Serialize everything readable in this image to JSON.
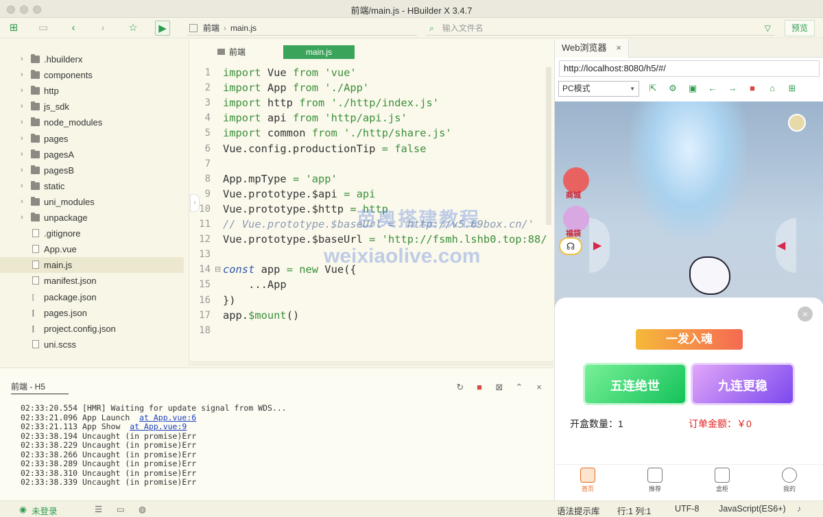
{
  "window": {
    "title": "前端/main.js - HBuilder X 3.4.7"
  },
  "toolbar": {
    "breadcrumb": [
      "前端",
      "main.js"
    ],
    "file_search_placeholder": "输入文件名",
    "preview_label": "预览"
  },
  "sidebar": {
    "items": [
      {
        "label": ".hbuilderx",
        "type": "folder"
      },
      {
        "label": "components",
        "type": "folder"
      },
      {
        "label": "http",
        "type": "folder"
      },
      {
        "label": "js_sdk",
        "type": "folder"
      },
      {
        "label": "node_modules",
        "type": "folder"
      },
      {
        "label": "pages",
        "type": "folder"
      },
      {
        "label": "pagesA",
        "type": "folder"
      },
      {
        "label": "pagesB",
        "type": "folder"
      },
      {
        "label": "static",
        "type": "folder"
      },
      {
        "label": "uni_modules",
        "type": "folder"
      },
      {
        "label": "unpackage",
        "type": "folder"
      },
      {
        "label": ".gitignore",
        "type": "file"
      },
      {
        "label": "App.vue",
        "type": "vue"
      },
      {
        "label": "main.js",
        "type": "js",
        "active": true
      },
      {
        "label": "manifest.json",
        "type": "manifest"
      },
      {
        "label": "package.json",
        "type": "json"
      },
      {
        "label": "pages.json",
        "type": "json"
      },
      {
        "label": "project.config.json",
        "type": "json"
      },
      {
        "label": "uni.scss",
        "type": "scss"
      }
    ]
  },
  "editor": {
    "tabs": [
      "前端",
      "main.js"
    ],
    "line_numbers": [
      "1",
      "2",
      "3",
      "4",
      "5",
      "6",
      "7",
      "8",
      "9",
      "10",
      "11",
      "12",
      "13",
      "14",
      "15",
      "16",
      "17",
      "18"
    ],
    "lines": [
      {
        "p1": "import ",
        "p2": "Vue ",
        "p3": "from ",
        "p4": "'vue'"
      },
      {
        "p1": "import ",
        "p2": "App ",
        "p3": "from ",
        "p4": "'./App'"
      },
      {
        "p1": "import ",
        "p2": "http ",
        "p3": "from ",
        "p4": "'./http/index.js'"
      },
      {
        "p1": "import ",
        "p2": "api ",
        "p3": "from ",
        "p4": "'http/api.js'"
      },
      {
        "p1": "import ",
        "p2": "common ",
        "p3": "from ",
        "p4": "'./http/share.js'"
      },
      {
        "p1": "Vue.config.productionTip ",
        "p2": "= ",
        "p3": "false",
        "p4": ""
      },
      {
        "p1": "",
        "p2": "",
        "p3": "",
        "p4": ""
      },
      {
        "p1": "App.mpType ",
        "p2": "= ",
        "p3": "'app'",
        "p4": ""
      },
      {
        "p1": "Vue.prototype.$api ",
        "p2": "= ",
        "p3": "api",
        "p4": ""
      },
      {
        "p1": "Vue.prototype.$http ",
        "p2": "= ",
        "p3": "http",
        "p4": ""
      },
      {
        "comment": "// Vue.prototype.$baseUrl = 'http://v5.69box.cn/'"
      },
      {
        "p1": "Vue.prototype.$baseUrl ",
        "p2": "= ",
        "p3": "'http://fsmh.lshb0.top:88/",
        "p4": ""
      },
      {
        "p1": "",
        "p2": "",
        "p3": "",
        "p4": ""
      },
      {
        "p1": "const ",
        "p2": "app ",
        "p3": "= new ",
        "p4": "Vue({"
      },
      {
        "p1": "    ...App",
        "p2": "",
        "p3": "",
        "p4": ""
      },
      {
        "p1": "})",
        "p2": "",
        "p3": "",
        "p4": ""
      },
      {
        "p1": "app.",
        "p2": "$mount",
        "p3": "()",
        "p4": ""
      },
      {
        "p1": "",
        "p2": "",
        "p3": "",
        "p4": ""
      }
    ]
  },
  "console": {
    "tab_label": "前端 - H5",
    "logs": [
      {
        "text": "02:33:20.554 [HMR] Waiting for update signal from WDS...",
        "link": ""
      },
      {
        "text": "02:33:21.096 App Launch  ",
        "link": "at App.vue:6"
      },
      {
        "text": "02:33:21.113 App Show  ",
        "link": "at App.vue:9"
      },
      {
        "text": "02:33:38.194 Uncaught (in promise)Err",
        "link": ""
      },
      {
        "text": "02:33:38.229 Uncaught (in promise)Err",
        "link": ""
      },
      {
        "text": "02:33:38.266 Uncaught (in promise)Err",
        "link": ""
      },
      {
        "text": "02:33:38.289 Uncaught (in promise)Err",
        "link": ""
      },
      {
        "text": "02:33:38.310 Uncaught (in promise)Err",
        "link": ""
      },
      {
        "text": "02:33:38.339 Uncaught (in promise)Err",
        "link": ""
      }
    ]
  },
  "browser": {
    "tab_title": "Web浏览器",
    "url": "http://localhost:8080/h5/#/",
    "mode": "PC模式",
    "side_labels": [
      "商城",
      "福袋"
    ],
    "sheet": {
      "one_shot": "一发入魂",
      "five": "五连绝世",
      "nine": "九连更稳",
      "box_count": "开盒数量：1",
      "order_amount": "订单金额：￥0"
    },
    "tabs": [
      "首页",
      "推荐",
      "盒柜",
      "我的"
    ]
  },
  "statusbar": {
    "login": "未登录",
    "syntax_hint": "语法提示库",
    "position": "行:1  列:1",
    "encoding": "UTF-8",
    "language": "JavaScript(ES6+)"
  },
  "watermark": {
    "cn": "芭奥搭建教程",
    "en": "weixiaolive.com"
  },
  "colors": {
    "accent": "#2e9c4f",
    "active_tab": "#3aa55a",
    "error": "#e02020"
  }
}
